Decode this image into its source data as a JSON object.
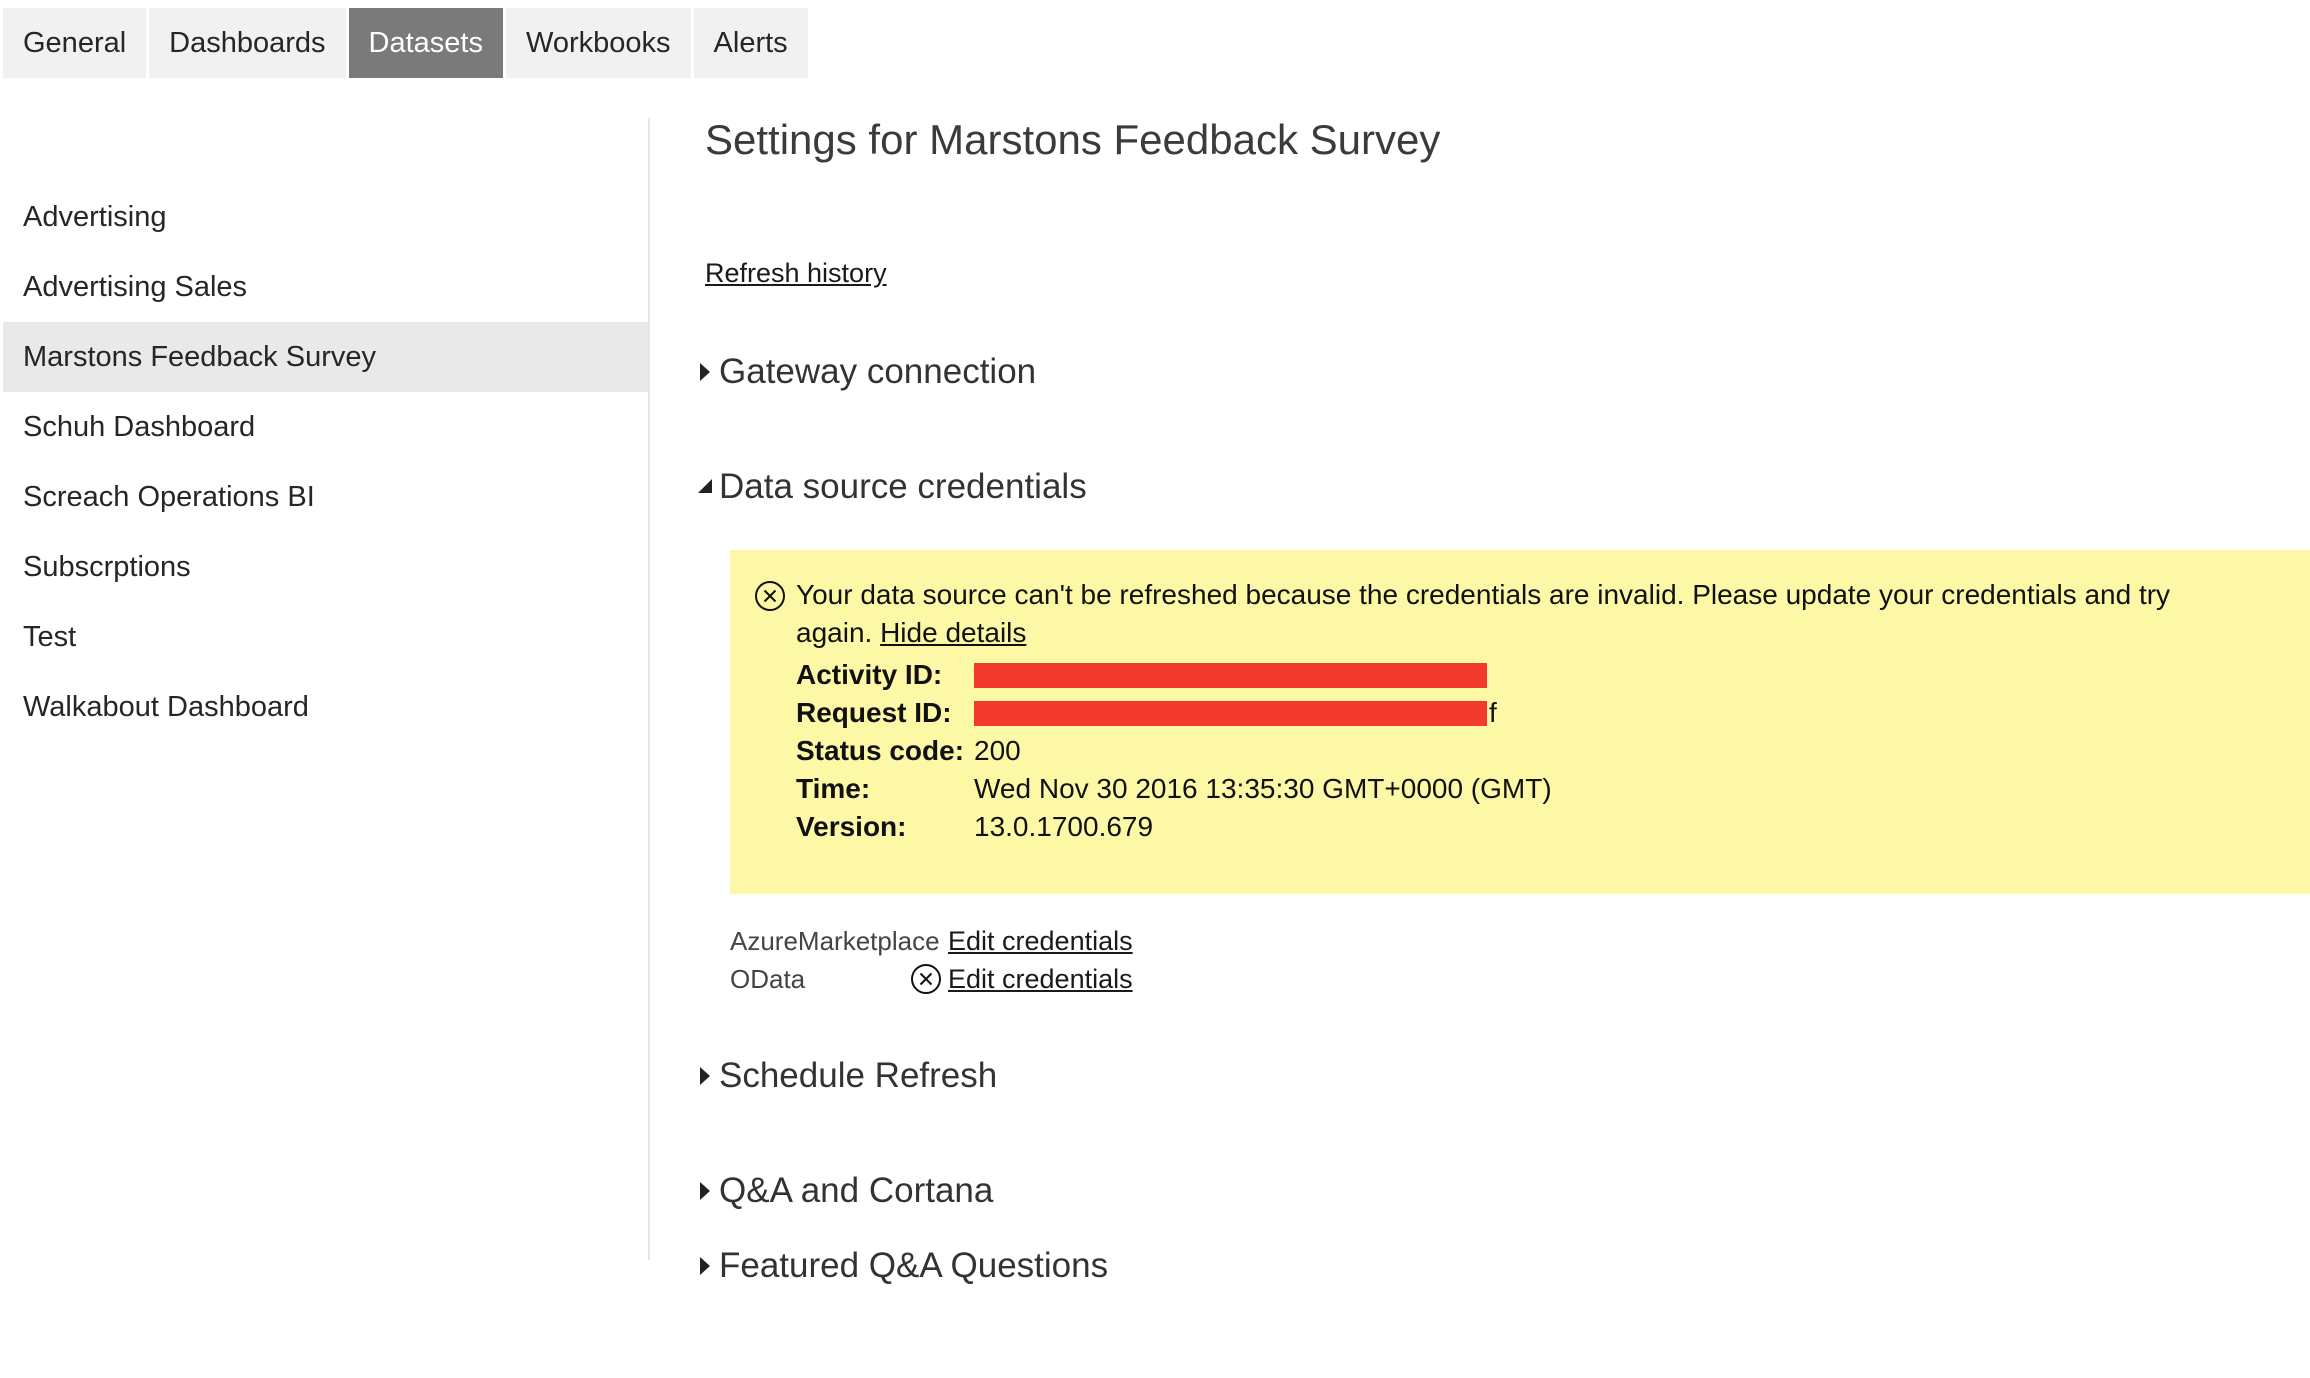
{
  "tabs": [
    {
      "label": "General"
    },
    {
      "label": "Dashboards"
    },
    {
      "label": "Datasets"
    },
    {
      "label": "Workbooks"
    },
    {
      "label": "Alerts"
    }
  ],
  "active_tab": "Datasets",
  "sidebar": {
    "items": [
      {
        "label": "Advertising"
      },
      {
        "label": "Advertising Sales"
      },
      {
        "label": "Marstons Feedback Survey"
      },
      {
        "label": "Schuh Dashboard"
      },
      {
        "label": "Screach Operations BI"
      },
      {
        "label": "Subscrptions"
      },
      {
        "label": "Test"
      },
      {
        "label": "Walkabout Dashboard"
      }
    ],
    "selected": "Marstons Feedback Survey"
  },
  "main": {
    "title": "Settings for Marstons Feedback Survey",
    "refresh_history": "Refresh history",
    "sections": {
      "gateway": "Gateway connection",
      "credentials": "Data source credentials",
      "schedule": "Schedule Refresh",
      "qa": "Q&A and Cortana",
      "featured": "Featured Q&A Questions"
    },
    "error": {
      "message": "Your data source can't be refreshed because the credentials are invalid. Please update your credentials and try again.",
      "hide_details": "Hide details",
      "details": {
        "activity_label": "Activity ID:",
        "request_label": "Request ID:",
        "request_tail": "f",
        "status_label": "Status code:",
        "status_value": "200",
        "time_label": "Time:",
        "time_value": "Wed Nov 30 2016 13:35:30 GMT+0000 (GMT)",
        "version_label": "Version:",
        "version_value": "13.0.1700.679"
      }
    },
    "credentials_list": [
      {
        "name": "AzureMarketplace",
        "link": "Edit credentials",
        "has_error": false
      },
      {
        "name": "OData",
        "link": "Edit credentials",
        "has_error": true
      }
    ]
  },
  "colors": {
    "active_tab_bg": "#7a7a7a",
    "tab_bg": "#f1f1f1",
    "selected_item_bg": "#e9e9e9",
    "error_bg": "#fdf8a6",
    "redaction": "#f23a2e"
  },
  "icons": {
    "collapsed": "triangle-right-icon",
    "expanded": "triangle-down-icon",
    "error": "circle-x-icon"
  }
}
